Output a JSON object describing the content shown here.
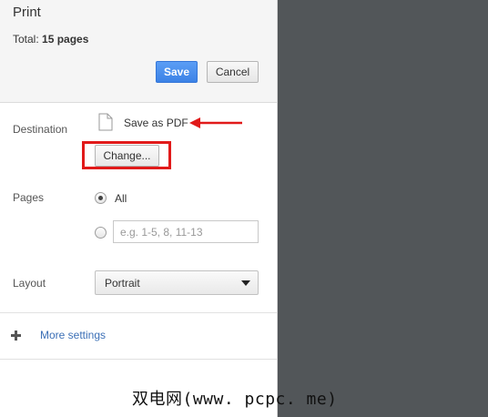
{
  "header": {
    "title": "Print",
    "total_label": "Total:",
    "total_value": "15 pages",
    "save_label": "Save",
    "cancel_label": "Cancel"
  },
  "destination": {
    "label": "Destination",
    "name": "Save as PDF",
    "icon": "document-icon",
    "change_label": "Change..."
  },
  "pages": {
    "label": "Pages",
    "option_all": "All",
    "selected": "All",
    "custom_placeholder": "e.g. 1-5, 8, 11-13",
    "custom_value": ""
  },
  "layout": {
    "label": "Layout",
    "selected": "Portrait"
  },
  "more_settings": {
    "label": "More settings",
    "icon": "plus-icon"
  },
  "watermark": "双电网(www. pcpc. me)",
  "colors": {
    "accent": "#3c82e6",
    "highlight": "#e11a1a",
    "preview_bg": "#525659",
    "link": "#3b6fb6"
  }
}
